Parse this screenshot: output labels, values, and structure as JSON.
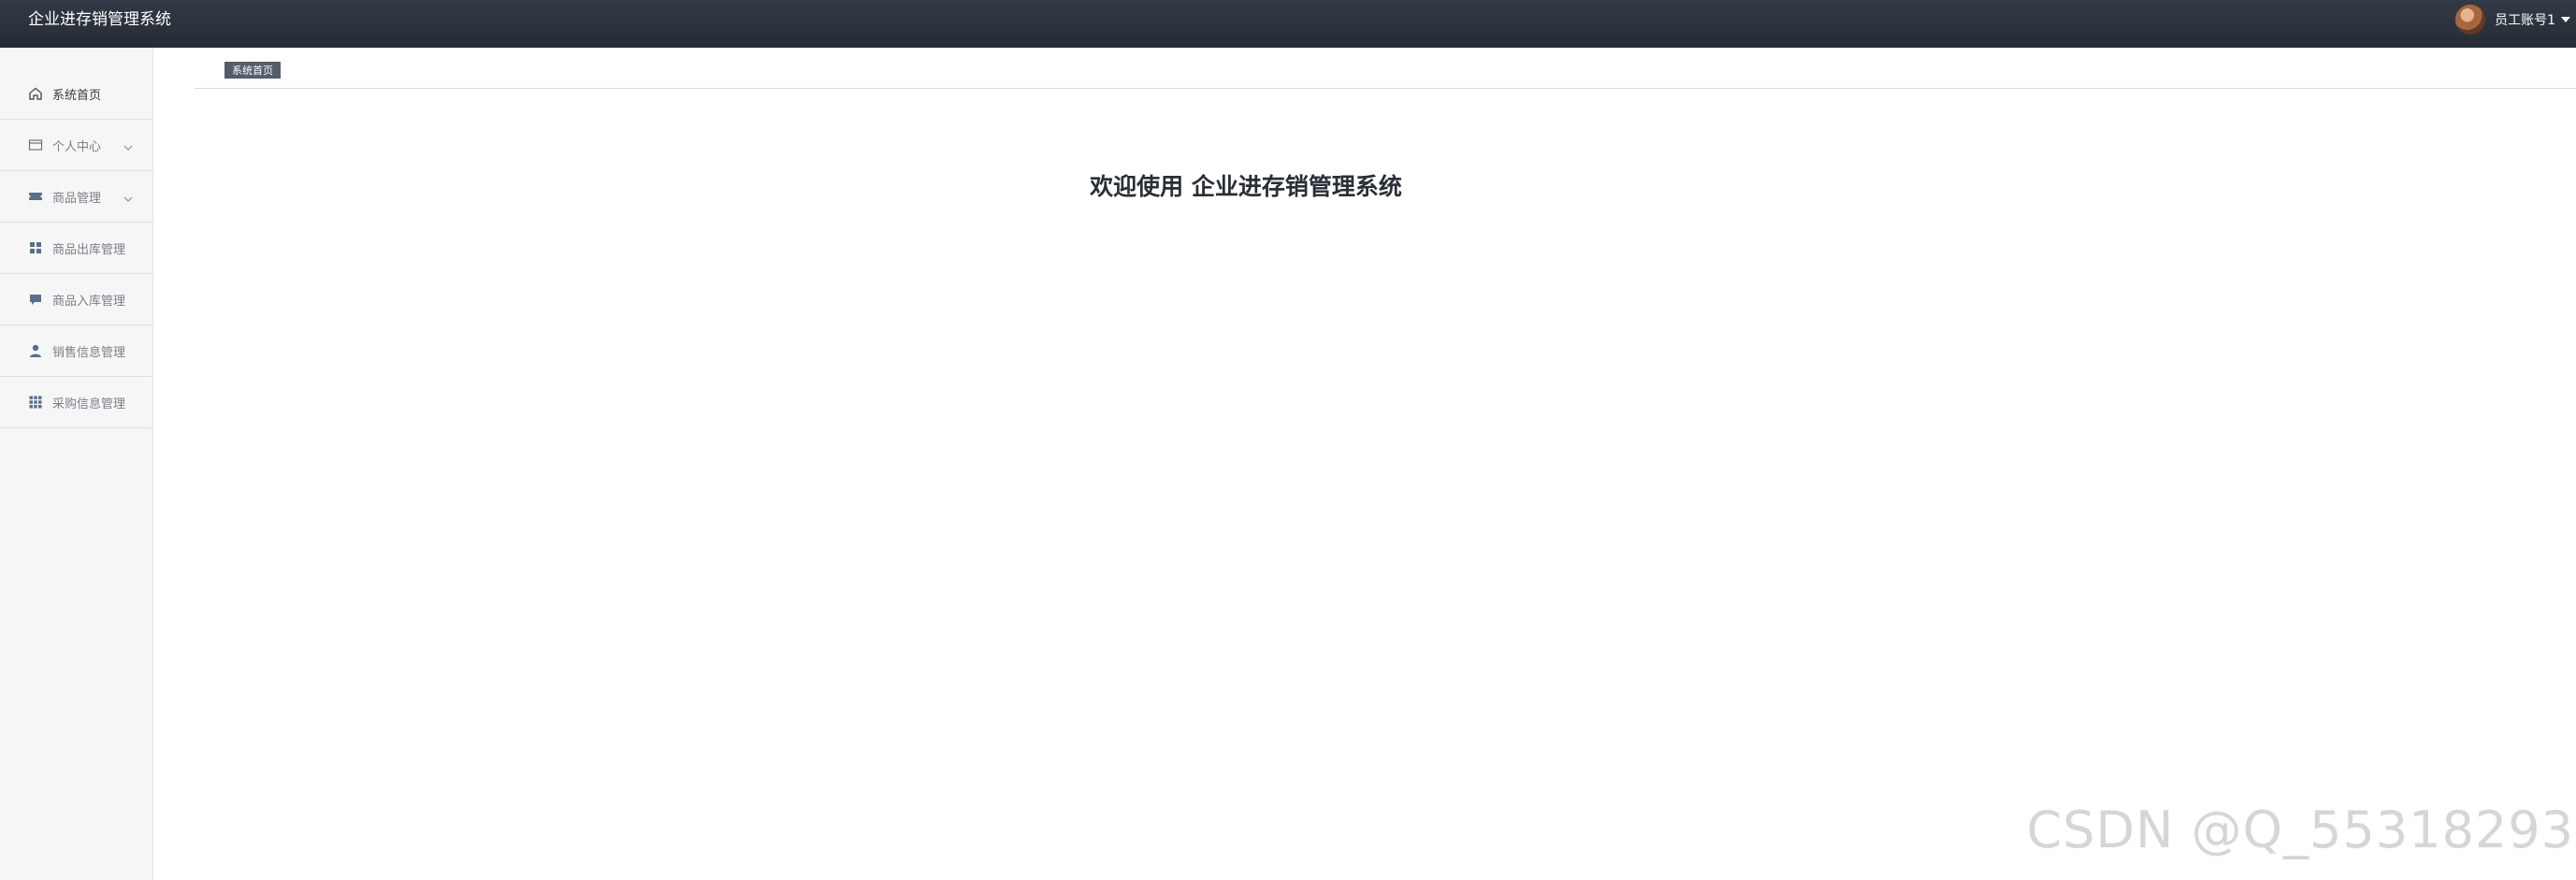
{
  "app": {
    "title": "企业进存销管理系统"
  },
  "user": {
    "name": "员工账号1"
  },
  "sidebar": {
    "items": [
      {
        "label": "系统首页",
        "icon": "home-icon",
        "has_children": false,
        "active": true
      },
      {
        "label": "个人中心",
        "icon": "card-icon",
        "has_children": true,
        "active": false
      },
      {
        "label": "商品管理",
        "icon": "ticket-icon",
        "has_children": true,
        "active": false
      },
      {
        "label": "商品出库管理",
        "icon": "grid-icon",
        "has_children": false,
        "active": false
      },
      {
        "label": "商品入库管理",
        "icon": "message-icon",
        "has_children": false,
        "active": false
      },
      {
        "label": "销售信息管理",
        "icon": "user-icon",
        "has_children": false,
        "active": false
      },
      {
        "label": "采购信息管理",
        "icon": "apps-icon",
        "has_children": false,
        "active": false
      }
    ]
  },
  "tabs": [
    {
      "label": "系统首页",
      "active": true
    }
  ],
  "main": {
    "welcome": "欢迎使用 企业进存销管理系统"
  },
  "watermark": {
    "text": "CSDN @Q_55318293"
  },
  "colors": {
    "topbar": "#2b323c",
    "sidebar_bg": "#f6f6f6",
    "tab_active_bg": "#545d6b",
    "icon": "#5a6f8a"
  }
}
